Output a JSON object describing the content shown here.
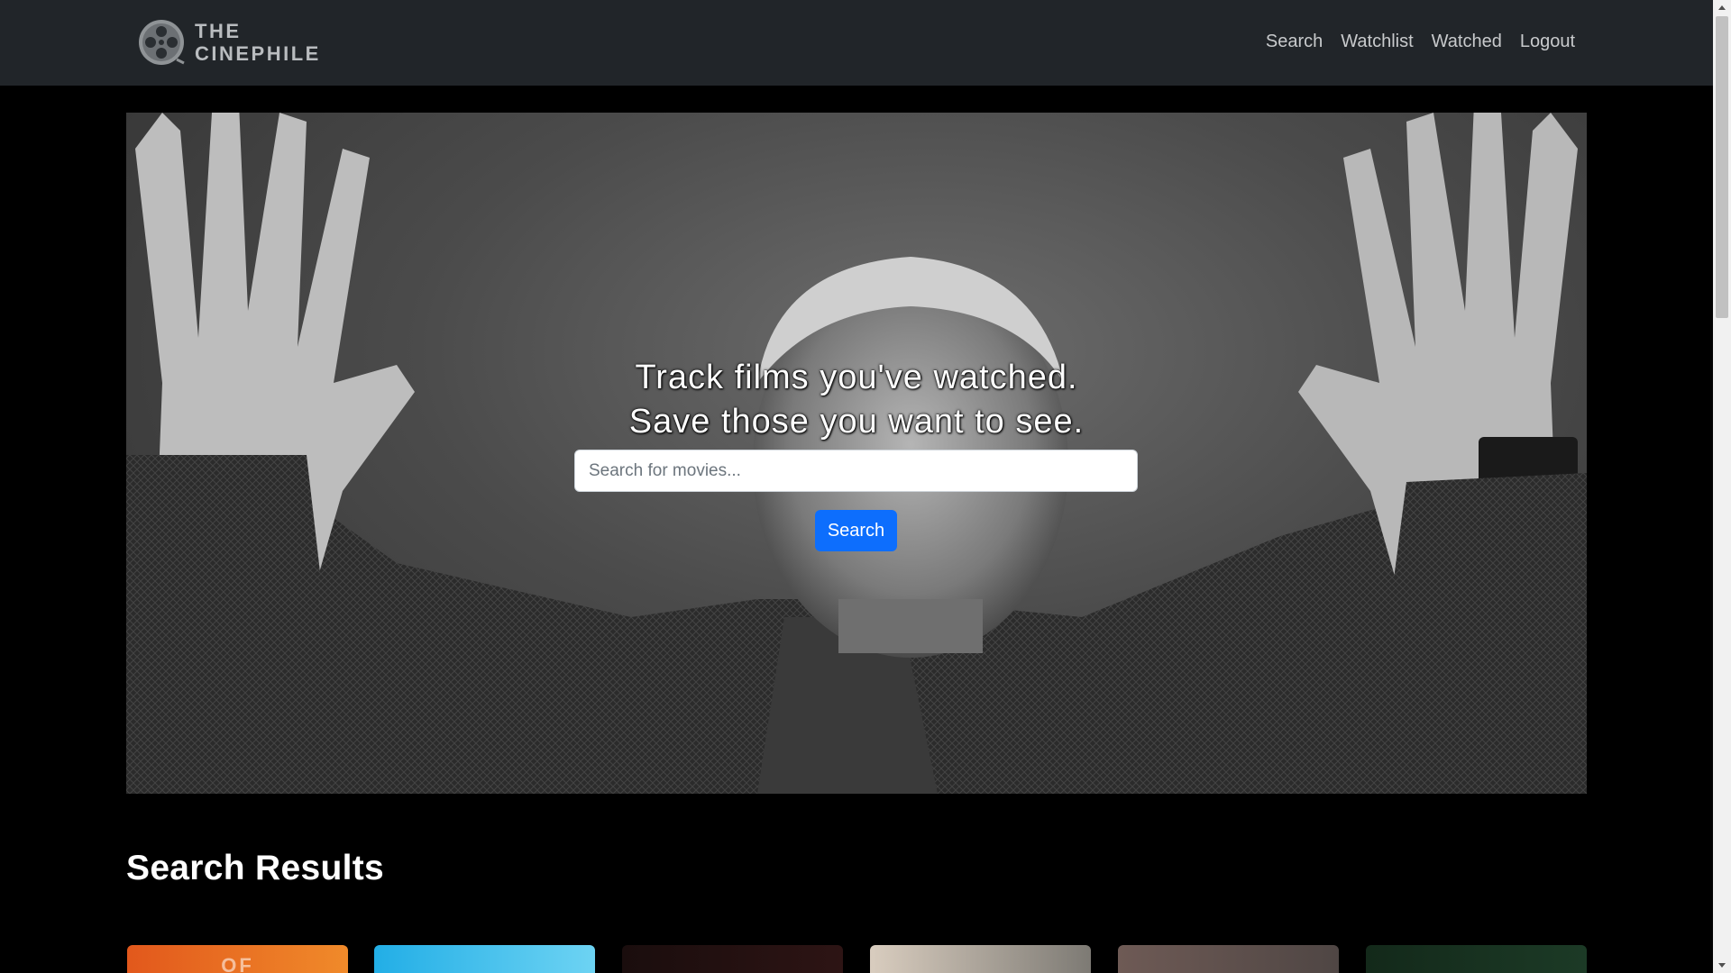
{
  "brand": {
    "line1": "THE",
    "line2": "CINEPHILE",
    "logo_icon": "film-reel-icon"
  },
  "nav": {
    "items": [
      {
        "label": "Search"
      },
      {
        "label": "Watchlist"
      },
      {
        "label": "Watched"
      },
      {
        "label": "Logout"
      }
    ]
  },
  "hero": {
    "line1": "Track films you've watched.",
    "line2": "Save those you want to see.",
    "search_placeholder": "Search for movies...",
    "search_value": "",
    "search_button": "Search"
  },
  "results": {
    "title": "Search Results",
    "cards": [
      {
        "caption": "OF",
        "colors": [
          "#e2581c",
          "#f08a2a"
        ]
      },
      {
        "caption": "",
        "colors": [
          "#22aee6",
          "#6dd3f3"
        ]
      },
      {
        "caption": "",
        "colors": [
          "#1a0d0d",
          "#2d1414"
        ]
      },
      {
        "caption": "",
        "colors": [
          "#d9cdbf",
          "#7d7a74"
        ]
      },
      {
        "caption": "",
        "colors": [
          "#6e5a55",
          "#4f4644"
        ]
      },
      {
        "caption": "",
        "colors": [
          "#13291a",
          "#1c3a26"
        ]
      }
    ]
  },
  "theme": {
    "accent": "#0d6efd",
    "navbar_bg": "#212529",
    "page_bg": "#000000"
  }
}
